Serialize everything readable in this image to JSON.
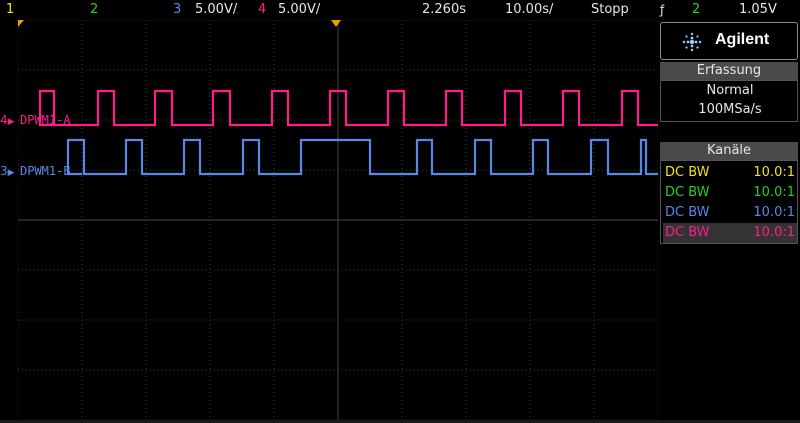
{
  "statusbar": {
    "ch1": "1",
    "ch2": "2",
    "ch3": "3",
    "ch3_scale": "5.00V/",
    "ch4": "4",
    "ch4_scale": "5.00V/",
    "time_offset": "2.260s",
    "time_per_div": "10.00s/",
    "run_state": "Stopp",
    "trigger_icon": "trigger-edge-icon",
    "trigger_channel": "2",
    "trigger_level": "1.05V"
  },
  "colors": {
    "ch1": "#f2e21b",
    "ch2": "#27d11f",
    "ch3": "#5b86e8",
    "ch4": "#ff1c8a",
    "grid": "#3a3a3a"
  },
  "panel": {
    "brand": "Agilent",
    "acquisition_title": "Erfassung",
    "acquisition_mode": "Normal",
    "sample_rate": "100MSa/s",
    "channels_title": "Kanäle",
    "channels": [
      {
        "coupling": "DC BW",
        "probe": "10.0:1",
        "color": "#f2e21b"
      },
      {
        "coupling": "DC BW",
        "probe": "10.0:1",
        "color": "#27d11f"
      },
      {
        "coupling": "DC BW",
        "probe": "10.0:1",
        "color": "#5b86e8"
      },
      {
        "coupling": "DC BW",
        "probe": "10.0:1",
        "color": "#ff1c8a"
      }
    ]
  },
  "traces": {
    "ch4_label": "DPWM1-A",
    "ch4_number": "4",
    "ch3_label": "DPWM1-B",
    "ch3_number": "3"
  }
}
